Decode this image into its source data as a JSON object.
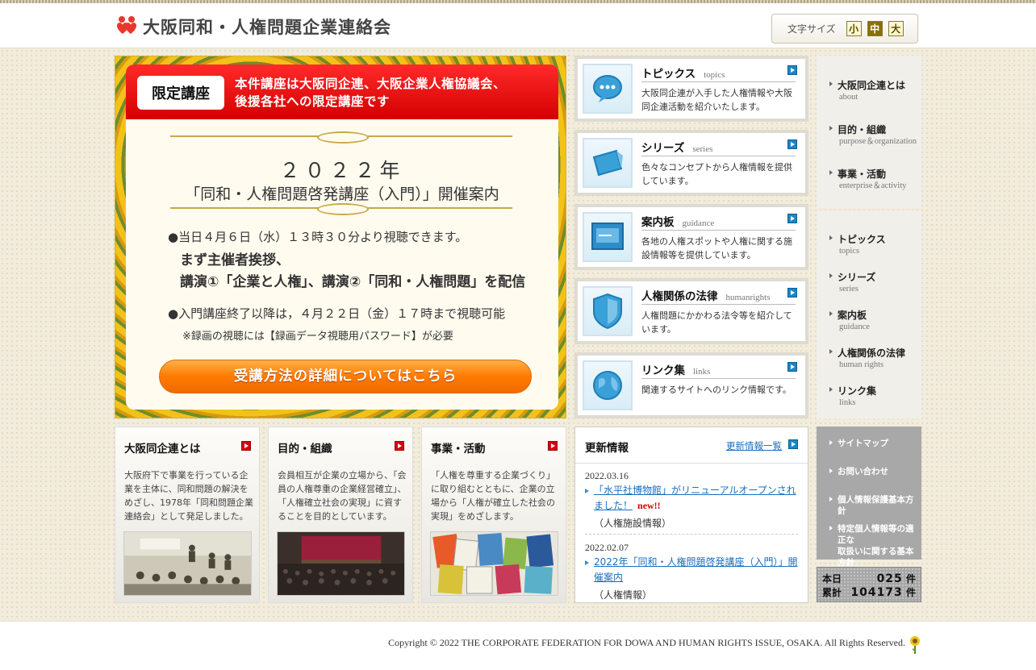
{
  "header": {
    "site_title": "大阪同和・人権問題企業連絡会",
    "font_size_label": "文字サイズ",
    "font_sizes": [
      "小",
      "中",
      "大"
    ],
    "font_size_selected": "中"
  },
  "banner": {
    "tag": "限定講座",
    "notice_line1": "本件講座は大阪同企連、大阪企業人権協議会、",
    "notice_line2": "後援各社への限定講座です",
    "year": "２０２２年",
    "title": "「同和・人権問題啓発講座（入門）」開催案内",
    "line1": "●当日４月６日（水）１３時３０分より視聴できます。",
    "line2": "まず主催者挨拶、",
    "line3": "講演①「企業と人権」、講演②「同和・人権問題」を配信",
    "line4": "●入門講座終了以降は，４月２２日（金）１７時まで視聴可能",
    "line5": "※録画の視聴には【録画データ視聴用パスワード】が必要",
    "button": "受講方法の詳細についてはこちら"
  },
  "middle_boxes": [
    {
      "title": "トピックス",
      "en": "topics",
      "desc": "大阪同企連が入手した人権情報や大阪同企連活動を紹介いたします。"
    },
    {
      "title": "シリーズ",
      "en": "series",
      "desc": "色々なコンセプトから人権情報を提供しています。"
    },
    {
      "title": "案内板",
      "en": "guidance",
      "desc": "各地の人権スポットや人権に関する施設情報等を提供しています。"
    },
    {
      "title": "人権関係の法律",
      "en": "humanrights",
      "desc": "人権問題にかかわる法令等を紹介しています。"
    },
    {
      "title": "リンク集",
      "en": "links",
      "desc": "関連するサイトへのリンク情報です。"
    }
  ],
  "right_nav_top": [
    {
      "jp": "大阪同企連とは",
      "en": "about"
    },
    {
      "jp": "目的・組織",
      "en": "purpose＆organization"
    },
    {
      "jp": "事業・活動",
      "en": "enterprise＆activity"
    }
  ],
  "right_nav_mid": [
    {
      "jp": "トピックス",
      "en": "topics"
    },
    {
      "jp": "シリーズ",
      "en": "series"
    },
    {
      "jp": "案内板",
      "en": "guidance"
    },
    {
      "jp": "人権関係の法律",
      "en": "human rights"
    },
    {
      "jp": "リンク集",
      "en": "links"
    }
  ],
  "right_nav_bottom": [
    "サイトマップ",
    "お問い合わせ",
    "個人情報保護基本方針",
    "特定個人情報等の適正な",
    "取扱いに関する基本方針"
  ],
  "counter": {
    "today_label": "本日",
    "today": "025",
    "total_label": "累計",
    "total": "104173",
    "unit": "件"
  },
  "bottom_boxes": [
    {
      "title": "大阪同企連とは",
      "desc": "大阪府下で事業を行っている企業を主体に、同和問題の解決をめざし、1978年「同和問題企業連絡会」として発足しました。"
    },
    {
      "title": "目的・組織",
      "desc": "会員相互が企業の立場から、「会員の人権尊重の企業経営確立」、「人権確立社会の実現」に資することを目的としています。"
    },
    {
      "title": "事業・活動",
      "desc": "「人権を尊重する企業づくり」に取り組むとともに、企業の立場から「人権が確立した社会の実現」をめざします。"
    }
  ],
  "news": {
    "title": "更新情報",
    "more": "更新情報一覧",
    "items": [
      {
        "date": "2022.03.16",
        "link": "「水平社博物館」がリニューアルオープンされました！",
        "new": "new!!",
        "category": "（人権施設情報）"
      },
      {
        "date": "2022.02.07",
        "link": "2022年「同和・人権問題啓発講座（入門）」開催案内",
        "category": "（人権情報）"
      }
    ]
  },
  "footer": {
    "copyright": "Copyright © 2022 THE CORPORATE FEDERATION FOR DOWA AND HUMAN RIGHTS ISSUE, OSAKA. All Rights Reserved."
  }
}
